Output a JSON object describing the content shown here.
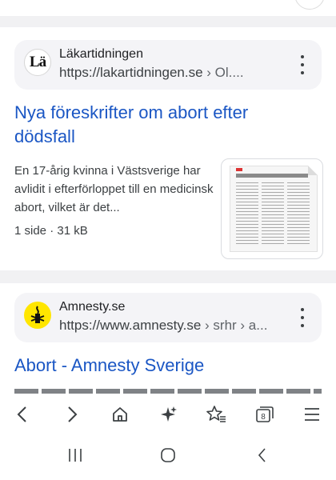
{
  "results": [
    {
      "site_name": "Läkartidningen",
      "favicon_text": "Lä",
      "url_main": "https://lakartidningen.se",
      "url_path": " › Ol....",
      "title": "Nya föreskrifter om abort efter dödsfall",
      "snippet": "En 17-årig kvinna i Västsverige har avlidit i efterförloppet till en medicinsk abort, vilket är det...",
      "meta": "1 side · 31 kB",
      "favicon_icon": "candle-icon"
    },
    {
      "site_name": "Amnesty.se",
      "url_main": "https://www.amnesty.se",
      "url_path": " › srhr › a...",
      "title": "Abort - Amnesty Sverige",
      "favicon_icon": "amnesty-candle-icon"
    }
  ],
  "toolbar": {
    "items": [
      "back-icon",
      "forward-icon",
      "home-icon",
      "sparkle-icon",
      "favorites-icon",
      "tabs-icon",
      "menu-icon"
    ],
    "tab_count": "8"
  },
  "navbar": {
    "items": [
      "recent-apps-icon",
      "home-circle-icon",
      "back-nav-icon"
    ]
  },
  "colors": {
    "link": "#1a56c4",
    "page_bg": "#f1f1f3",
    "amnesty_yellow": "#ffe600"
  }
}
